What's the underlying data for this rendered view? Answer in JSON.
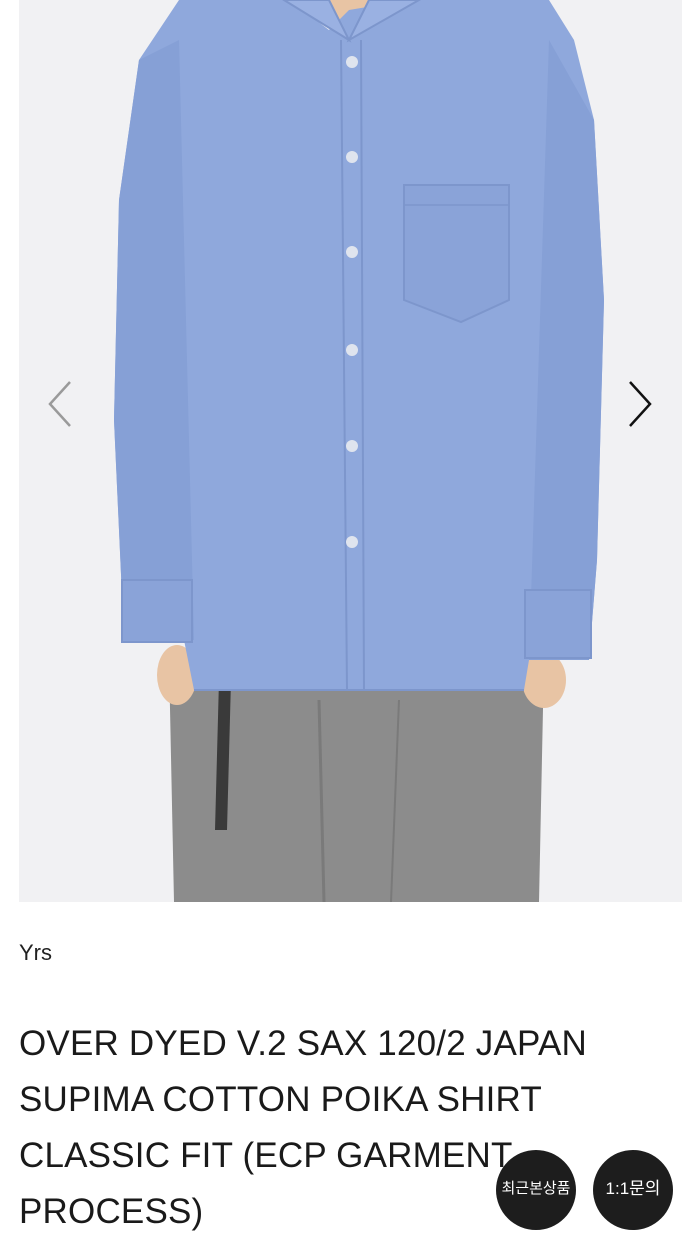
{
  "product": {
    "brand": "Yrs",
    "title": "OVER DYED V.2 SAX 120/2 JAPAN SUPIMA COTTON POIKA SHIRT CLASSIC FIT (ECP GARMENT PROCESS)"
  },
  "gallery": {
    "prev_icon": "chevron-left-icon",
    "next_icon": "chevron-right-icon"
  },
  "floating": {
    "recent_label": "최근본상품",
    "inquiry_label": "1:1문의"
  },
  "colors": {
    "shirt": "#8fa8dc",
    "pants": "#8c8c8c",
    "background": "#f1f1f3",
    "button": "#1d1d1d"
  }
}
